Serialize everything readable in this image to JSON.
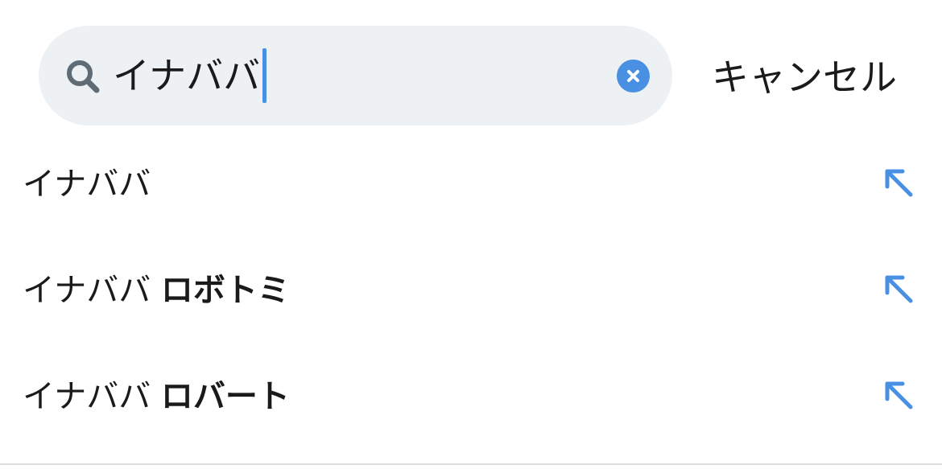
{
  "search": {
    "query": "イナババ",
    "clear_icon": "clear-icon",
    "search_icon": "search-icon"
  },
  "actions": {
    "cancel_label": "キャンセル"
  },
  "suggestions": [
    {
      "typed": "イナババ",
      "completion": "",
      "icon": "north-west-arrow-icon"
    },
    {
      "typed": "イナババ",
      "completion": "ロボトミ",
      "icon": "north-west-arrow-icon"
    },
    {
      "typed": "イナババ",
      "completion": "ロバート",
      "icon": "north-west-arrow-icon"
    }
  ],
  "colors": {
    "accent": "#4a90e2",
    "search_background": "#eef1f3",
    "text": "#1a1a1a",
    "icon_gray": "#5f6b75"
  }
}
